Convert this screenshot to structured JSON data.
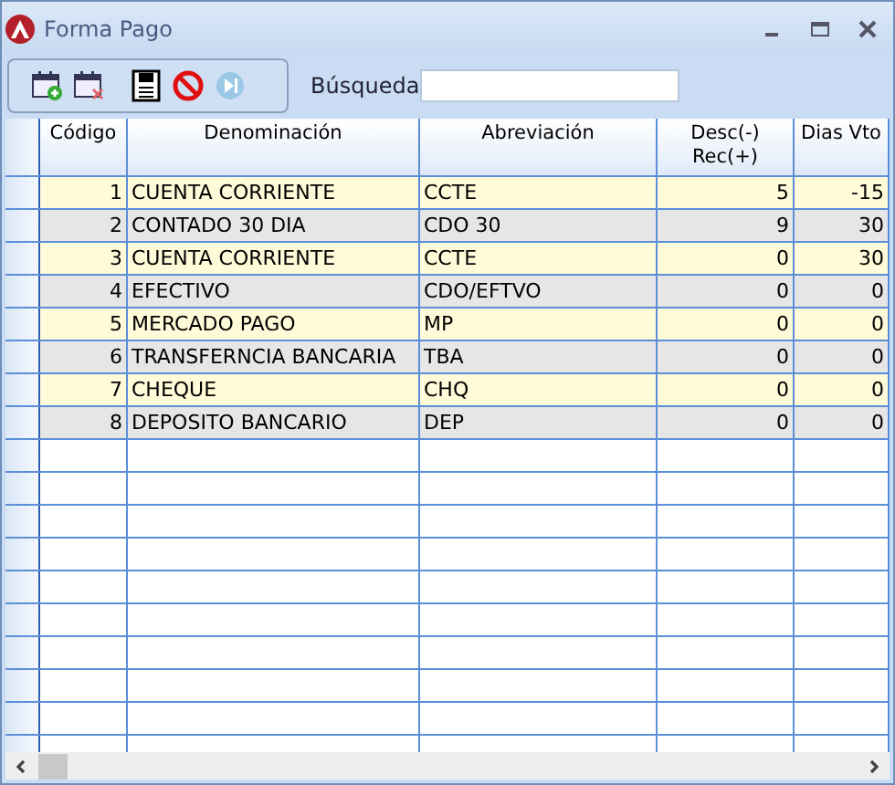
{
  "window": {
    "title": "Forma Pago"
  },
  "toolbar": {
    "search": {
      "label": "Búsqueda"
    }
  },
  "table": {
    "columns": [
      "Código",
      "Denominación",
      "Abreviación",
      "Desc(-) Rec(+)",
      "Dias Vto"
    ],
    "rows": [
      [
        "1",
        "CUENTA CORRIENTE",
        "CCTE",
        "5",
        "-15"
      ],
      [
        "2",
        "CONTADO 30 DIA",
        "CDO 30",
        "9",
        "30"
      ],
      [
        "3",
        "CUENTA CORRIENTE",
        "CCTE",
        "0",
        "30"
      ],
      [
        "4",
        "EFECTIVO",
        "CDO/EFTVO",
        "0",
        "0"
      ],
      [
        "5",
        "MERCADO PAGO",
        "MP",
        "0",
        "0"
      ],
      [
        "6",
        "TRANSFERNCIA BANCARIA",
        "TBA",
        "0",
        "0"
      ],
      [
        "7",
        "CHEQUE",
        "CHQ",
        "0",
        "0"
      ],
      [
        "8",
        "DEPOSITO BANCARIO",
        "DEP",
        "0",
        "0"
      ]
    ]
  }
}
